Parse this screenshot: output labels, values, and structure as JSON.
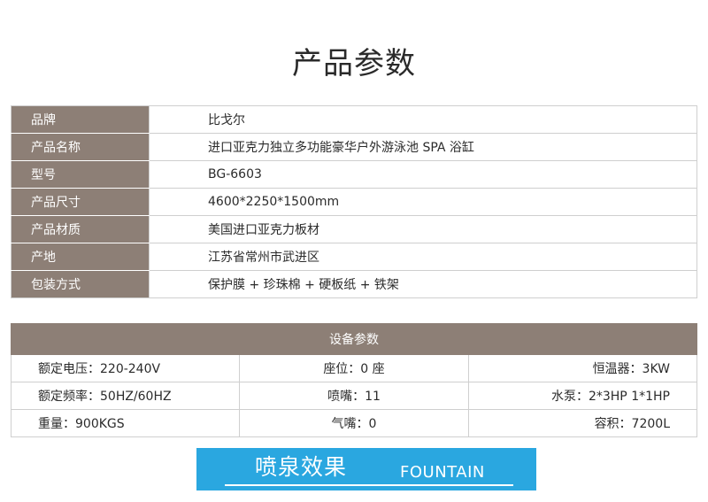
{
  "title": "产品参数",
  "specs": [
    {
      "label": "品牌",
      "value": "比戈尔"
    },
    {
      "label": "产品名称",
      "value": "进口亚克力独立多功能豪华户外游泳池 SPA 浴缸"
    },
    {
      "label": "型号",
      "value": "BG-6603"
    },
    {
      "label": "产品尺寸",
      "value": "4600*2250*1500mm"
    },
    {
      "label": "产品材质",
      "value": "美国进口亚克力板材"
    },
    {
      "label": "产地",
      "value": "江苏省常州市武进区"
    },
    {
      "label": "包装方式",
      "value": "保护膜 + 珍珠棉 + 硬板纸 + 铁架"
    }
  ],
  "equipment": {
    "header": "设备参数",
    "rows": [
      [
        "额定电压：220-240V",
        "座位：0 座",
        "恒温器：3KW"
      ],
      [
        "额定频率：50HZ/60HZ",
        "喷嘴：11",
        "水泵：2*3HP 1*1HP"
      ],
      [
        "重量：900KGS",
        "气嘴：0",
        "容积：7200L"
      ]
    ]
  },
  "banner": {
    "cn": "喷泉效果",
    "en": "FOUNTAIN"
  },
  "colors": {
    "label_bg": "#8d7f76",
    "banner_bg": "#2aa7e0"
  }
}
